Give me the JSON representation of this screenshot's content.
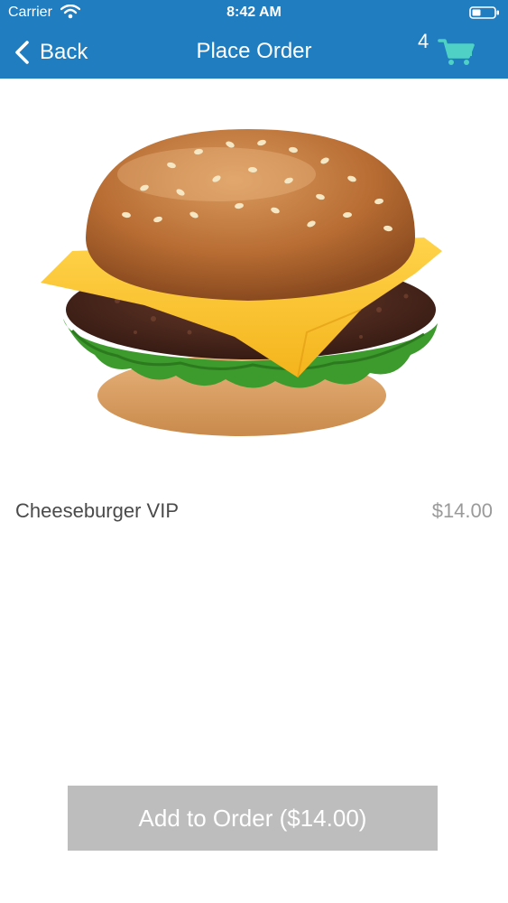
{
  "status_bar": {
    "carrier": "Carrier",
    "time": "8:42 AM",
    "icons": [
      "wifi-icon",
      "battery-icon"
    ]
  },
  "nav_bar": {
    "back_label": "Back",
    "title": "Place Order",
    "cart_count": "4",
    "icons": [
      "chevron-left-icon",
      "shopping-cart-icon"
    ]
  },
  "product": {
    "name": "Cheeseburger VIP",
    "price": "$14.00",
    "image": "cheeseburger-photo"
  },
  "actions": {
    "add_to_order_label": "Add to Order ($14.00)"
  },
  "colors": {
    "header_bg": "#1f7dc0",
    "cart_icon": "#4fd1c5",
    "button_bg": "#bdbdbd",
    "button_text": "#ffffff",
    "name_text": "#4a4a4a",
    "price_text": "#9a9a9a"
  }
}
